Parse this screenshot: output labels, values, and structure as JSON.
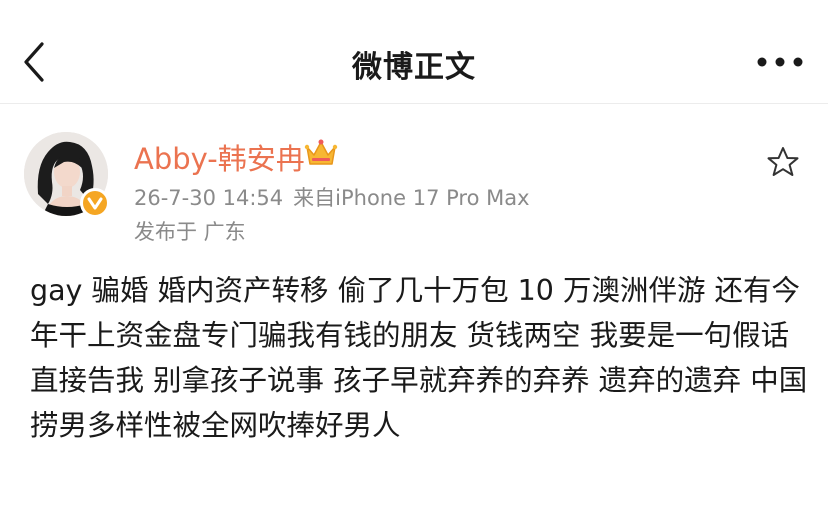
{
  "nav": {
    "title": "微博正文",
    "back_icon": "chevron-left-icon",
    "more_icon": "more-dots-icon"
  },
  "post": {
    "author": "Abby-韩安冉",
    "author_color": "#eb7350",
    "badge_icon": "crown-icon",
    "verified_icon": "verified-badge-icon",
    "timestamp": "26-7-30 14:54",
    "source": "来自iPhone 17 Pro Max",
    "location": "发布于 广东",
    "favorite_icon": "star-icon",
    "content": "gay 骗婚 婚内资产转移 偷了几十万包 10 万澳洲伴游 还有今年干上资金盘专门骗我有钱的朋友 货钱两空 我要是一句假话 直接告我 别拿孩子说事 孩子早就弃养的弃养 遗弃的遗弃 中国捞男多样性被全网吹捧好男人"
  }
}
